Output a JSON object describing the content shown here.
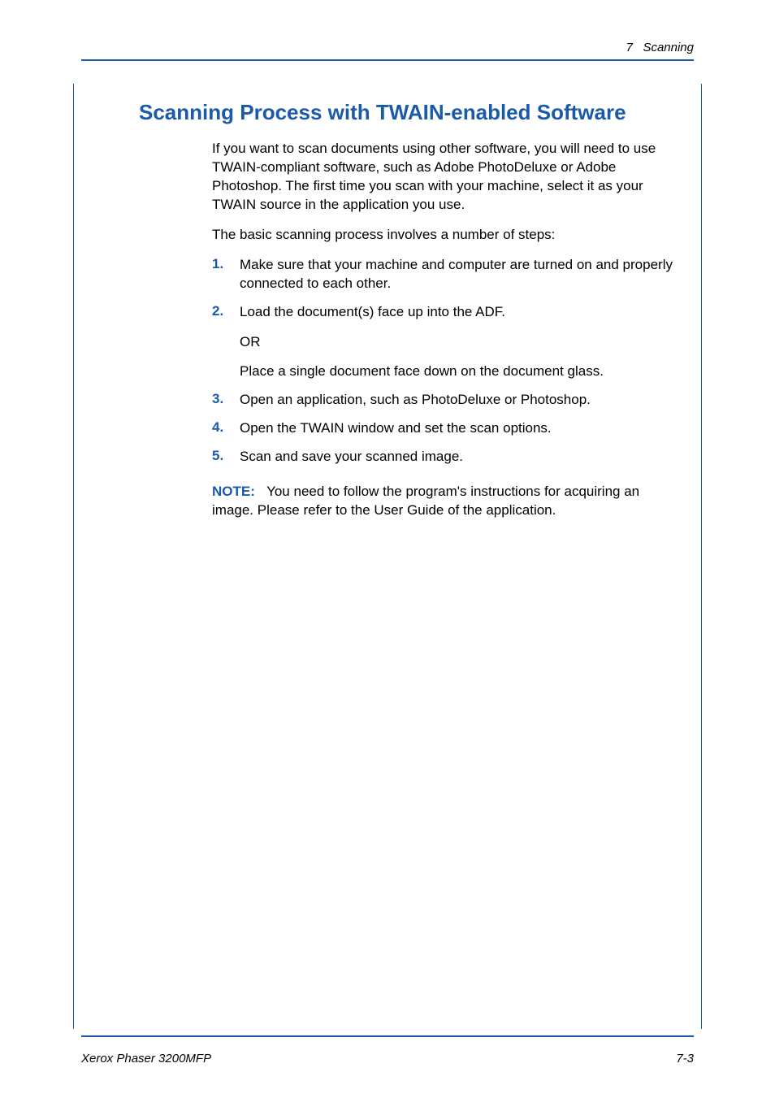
{
  "header": {
    "chapter_num": "7",
    "chapter_title": "Scanning"
  },
  "heading": "Scanning Process with TWAIN-enabled Software",
  "intro": "If you want to scan documents using other software, you will need to use TWAIN-compliant software, such as Adobe PhotoDeluxe or Adobe Photoshop. The first time you scan with your machine, select it as your TWAIN source in the application you use.",
  "lead_in": "The basic scanning process involves a number of steps:",
  "steps": [
    {
      "num": "1.",
      "text": "Make sure that your machine and computer are turned on and properly connected to each other."
    },
    {
      "num": "2.",
      "text": "Load the document(s) face up into the ADF.",
      "sub1": "OR",
      "sub2": "Place a single document face down on the document glass."
    },
    {
      "num": "3.",
      "text": "Open an application, such as PhotoDeluxe or Photoshop."
    },
    {
      "num": "4.",
      "text": "Open the TWAIN window and set the scan options."
    },
    {
      "num": "5.",
      "text": "Scan and save your scanned image."
    }
  ],
  "note": {
    "label": "NOTE:",
    "text": "You need to follow the program's instructions for acquiring an image. Please refer to the User Guide of the application."
  },
  "footer": {
    "left": "Xerox Phaser 3200MFP",
    "right": "7-3"
  }
}
